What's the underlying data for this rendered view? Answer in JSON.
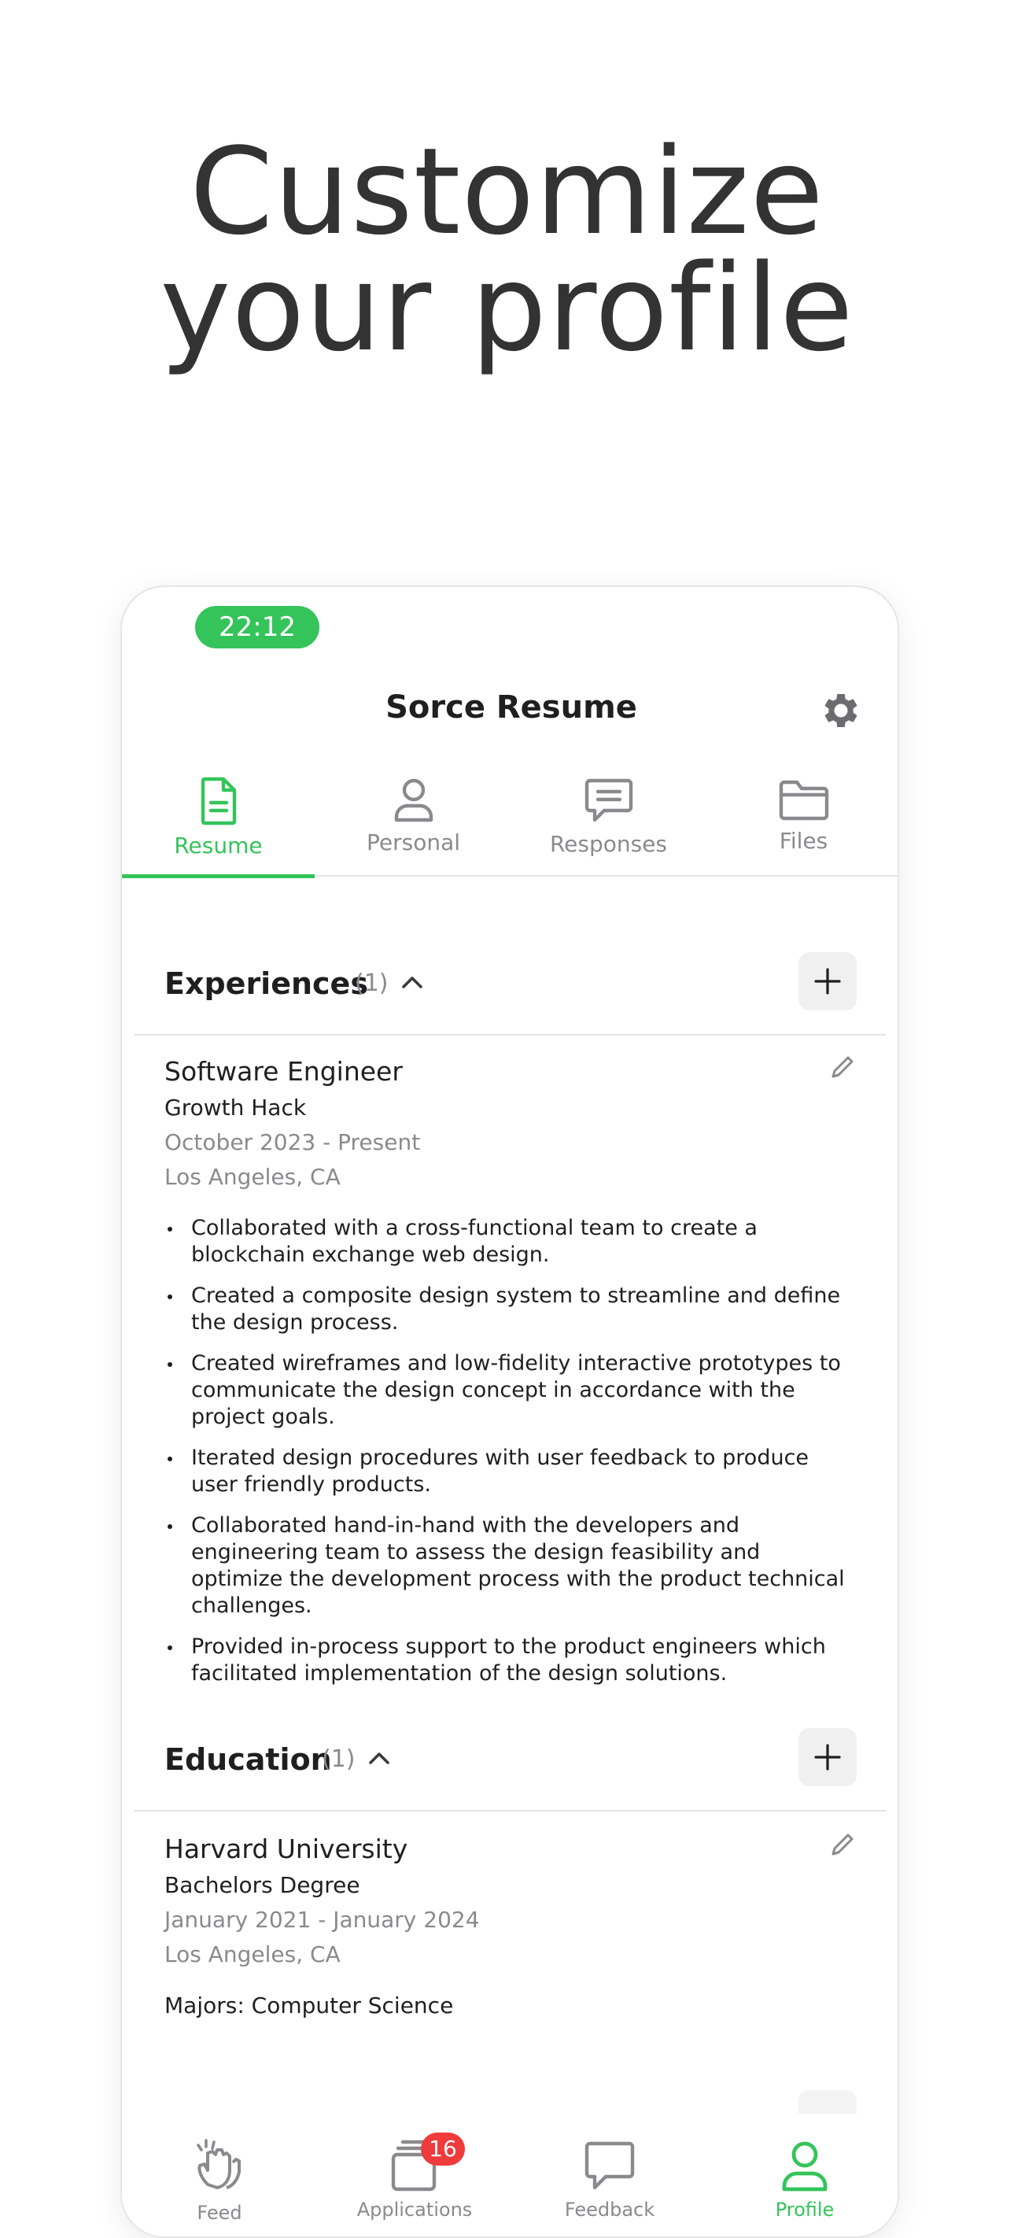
{
  "headline": {
    "line1": "Customize",
    "line2": "your profile"
  },
  "status_bar": {
    "time": "22:12"
  },
  "header": {
    "title": "Sorce Resume"
  },
  "tabs": [
    {
      "label": "Resume",
      "icon": "document-icon",
      "active": true
    },
    {
      "label": "Personal",
      "icon": "person-icon",
      "active": false
    },
    {
      "label": "Responses",
      "icon": "chat-bubble-icon",
      "active": false
    },
    {
      "label": "Files",
      "icon": "folder-icon",
      "active": false
    }
  ],
  "experiences": {
    "title": "Experiences",
    "count": "(1)",
    "items": [
      {
        "title": "Software Engineer",
        "company": "Growth Hack",
        "dates": "October 2023 - Present",
        "location": "Los Angeles, CA",
        "bullets": [
          "Collaborated with a cross-functional team to create a blockchain exchange web design.",
          "Created a composite design system to streamline and define the design process.",
          "Created wireframes and low-fidelity interactive prototypes to communicate the design concept in accordance with the project goals.",
          "Iterated design procedures with user feedback to produce user friendly products.",
          "Collaborated hand-in-hand with the developers and engineering team to assess the design feasibility and optimize the development process with the product technical challenges.",
          "Provided in-process support to the product engineers which facilitated implementation of the design solutions."
        ]
      }
    ]
  },
  "education": {
    "title": "Education",
    "count": "(1)",
    "items": [
      {
        "school": "Harvard University",
        "degree": "Bachelors Degree",
        "dates": "January 2021 - January 2024",
        "location": "Los Angeles, CA",
        "majors": "Majors: Computer Science"
      }
    ]
  },
  "bottom_nav": [
    {
      "label": "Feed",
      "icon": "clapping-hands-icon",
      "active": false
    },
    {
      "label": "Applications",
      "icon": "cards-stack-icon",
      "active": false,
      "badge": "16"
    },
    {
      "label": "Feedback",
      "icon": "chat-bubble-icon",
      "active": false
    },
    {
      "label": "Profile",
      "icon": "person-icon",
      "active": true
    }
  ],
  "colors": {
    "accent": "#34c45a",
    "badge": "#ef3b3b",
    "muted": "#8a8a8e",
    "text": "#1f1f1f"
  }
}
